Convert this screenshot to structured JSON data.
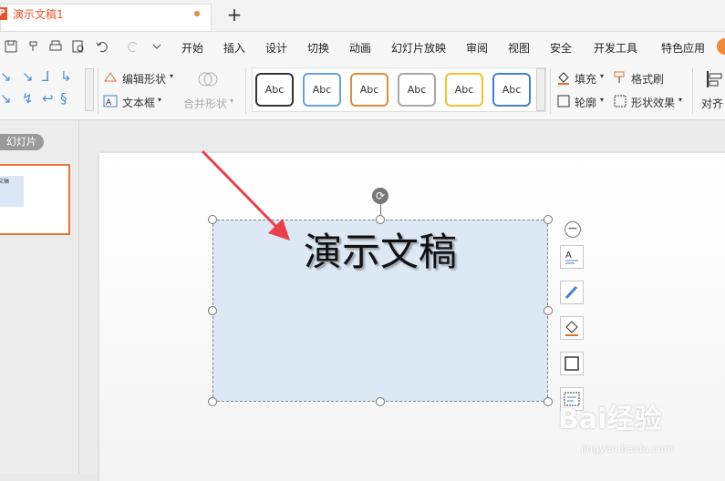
{
  "titlebar": {
    "app_logo": "P",
    "doc_title": "演示文稿1",
    "new_tab": "+"
  },
  "menu": {
    "items": [
      "开始",
      "插入",
      "设计",
      "切换",
      "动画",
      "幻灯片放映",
      "审阅",
      "视图",
      "安全",
      "开发工具",
      "特色应用"
    ]
  },
  "quick_access": {
    "icons": [
      "save-icon",
      "format-painter-icon",
      "print-icon",
      "print-preview-icon",
      "undo-icon",
      "redo-icon",
      "customize-icon"
    ]
  },
  "ribbon": {
    "edit_shape": "编辑形状",
    "text_box": "文本框",
    "merge_shapes": "合并形状",
    "style_label": "Abc",
    "style_border_colors": [
      "#333333",
      "#6aa0d8",
      "#e6893a",
      "#a8a8a8",
      "#f2c12e",
      "#4a7fc9"
    ],
    "fill": "填充",
    "format_painter": "格式刷",
    "outline": "轮廓",
    "shape_effects": "形状效果",
    "align": "对齐"
  },
  "left_panel": {
    "tab_label": "幻灯片",
    "thumb_text": "文稿"
  },
  "slide": {
    "textbox_text": "演示文稿"
  },
  "watermark": {
    "main": "Bai经验",
    "sub": "jingyan.baidu.com"
  },
  "colors": {
    "accent": "#e8542a",
    "arrow": "#e8404a",
    "selection_fill": "#dde8f5"
  }
}
